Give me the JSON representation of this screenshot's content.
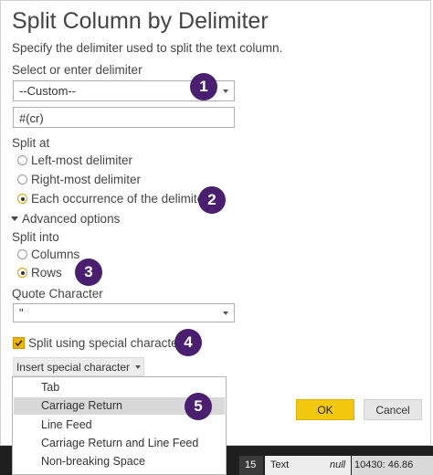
{
  "dialog": {
    "title": "Split Column by Delimiter",
    "subtitle": "Specify the delimiter used to split the text column."
  },
  "delimiter": {
    "label": "Select or enter delimiter",
    "selected": "--Custom--",
    "custom_value": "#(cr)"
  },
  "split_at": {
    "label": "Split at",
    "options": [
      "Left-most delimiter",
      "Right-most delimiter",
      "Each occurrence of the delimiter"
    ],
    "selected_index": 2
  },
  "advanced": {
    "label": "Advanced options",
    "icon": "triangle-down"
  },
  "split_into": {
    "label": "Split into",
    "options": [
      "Columns",
      "Rows"
    ],
    "selected_index": 1
  },
  "quote": {
    "label": "Quote Character",
    "selected": "\""
  },
  "special": {
    "label": "Split using special characters",
    "checked": true
  },
  "insert_button": {
    "label": "Insert special character"
  },
  "menu": {
    "items": [
      "Tab",
      "Carriage Return",
      "Line Feed",
      "Carriage Return and Line Feed",
      "Non-breaking Space"
    ],
    "highlighted_index": 1
  },
  "buttons": {
    "ok": "OK",
    "cancel": "Cancel"
  },
  "badges": [
    "1",
    "2",
    "3",
    "4",
    "5"
  ],
  "background_row": {
    "row_number": "15",
    "type": "Text",
    "null_text": "null",
    "value": "10430: 46.86"
  },
  "colors": {
    "badge": "#4b1f6f",
    "accent": "#f0b400",
    "ok_button": "#f2c811",
    "menu_highlight": "#d8d8d8",
    "dark_background": "#1f1f1f"
  }
}
